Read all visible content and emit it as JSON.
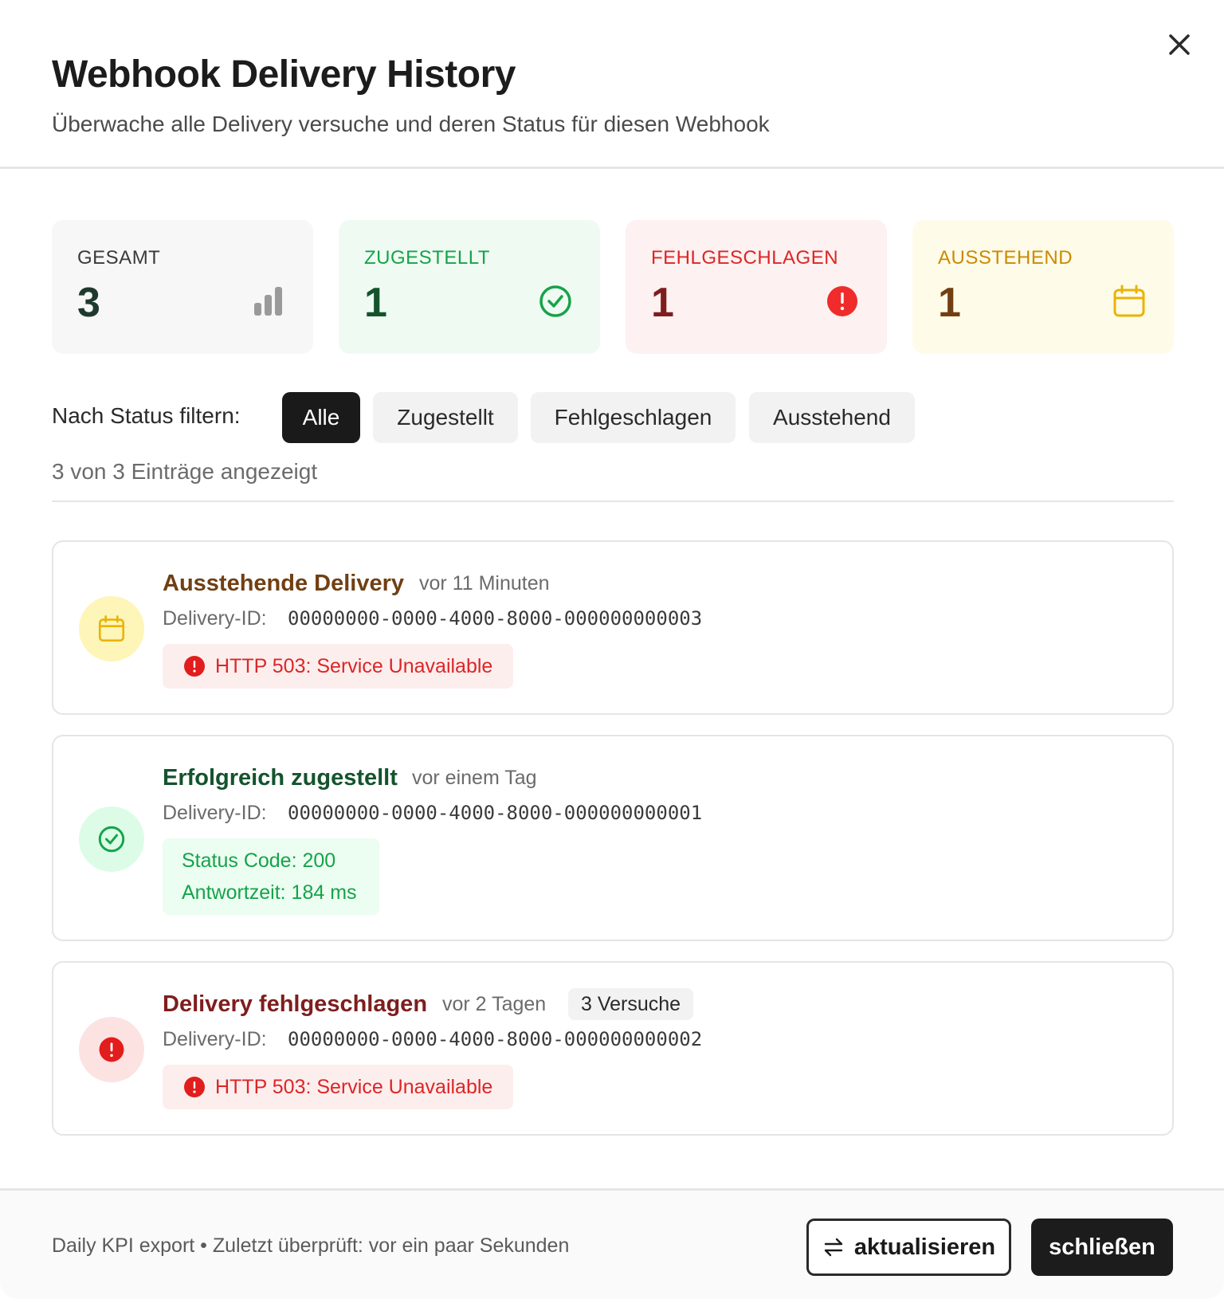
{
  "modal": {
    "title": "Webhook Delivery History",
    "subtitle": "Überwache alle Delivery versuche und deren Status für diesen Webhook"
  },
  "stats": {
    "total": {
      "label": "GESAMT",
      "value": "3",
      "icon": "bar-chart-icon"
    },
    "delivered": {
      "label": "ZUGESTELLT",
      "value": "1",
      "icon": "check-circle-icon"
    },
    "failed": {
      "label": "FEHLGESCHLAGEN",
      "value": "1",
      "icon": "alert-circle-icon"
    },
    "pending": {
      "label": "AUSSTEHEND",
      "value": "1",
      "icon": "calendar-icon"
    }
  },
  "filter": {
    "label": "Nach Status filtern:",
    "options": [
      "Alle",
      "Zugestellt",
      "Fehlgeschlagen",
      "Ausstehend"
    ],
    "selected": "Alle",
    "count_text": "3 von 3 Einträge angezeigt"
  },
  "deliveries": [
    {
      "status": "pending",
      "title": "Ausstehende Delivery",
      "time": "vor 11 Minuten",
      "id_label": "Delivery-ID:",
      "id": "00000000-0000-4000-8000-000000000003",
      "error": "HTTP 503: Service Unavailable"
    },
    {
      "status": "delivered",
      "title": "Erfolgreich zugestellt",
      "time": "vor einem Tag",
      "id_label": "Delivery-ID:",
      "id": "00000000-0000-4000-8000-000000000001",
      "status_code": "Status Code: 200",
      "response_time": "Antwortzeit: 184 ms"
    },
    {
      "status": "failed",
      "title": "Delivery fehlgeschlagen",
      "time": "vor 2 Tagen",
      "attempts": "3 Versuche",
      "id_label": "Delivery-ID:",
      "id": "00000000-0000-4000-8000-000000000002",
      "error": "HTTP 503: Service Unavailable"
    }
  ],
  "footer": {
    "info": "Daily KPI export • Zuletzt überprüft: vor ein paar Sekunden",
    "refresh_label": "aktualisieren",
    "close_label": "schließen"
  },
  "colors": {
    "delivered": "#16a34a",
    "failed": "#dc2626",
    "pending": "#ca8a04",
    "primary_button": "#1c1c1c"
  }
}
